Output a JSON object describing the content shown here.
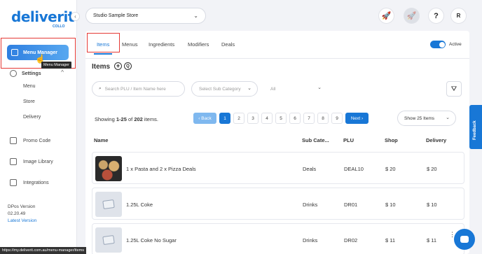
{
  "sidebar": {
    "logo": "deliverit",
    "logo_sub": "COLLO",
    "menu_manager": "Menu Manager",
    "tooltip": "Menu Manager",
    "settings": "Settings",
    "settings_sub": [
      "Menu",
      "Store",
      "Delivery"
    ],
    "items": [
      "Promo Code",
      "Image Library",
      "Integrations"
    ],
    "version_label": "DPos Version",
    "version": "02.20.49",
    "latest": "Latest Version"
  },
  "topbar": {
    "store": "Studio Sample Store",
    "help": "?",
    "user_initial": "R"
  },
  "tabs": [
    "Items",
    "Menus",
    "Ingredients",
    "Modifiers",
    "Deals"
  ],
  "active_tab": "Items",
  "toggle_label": "Active",
  "section_title": "Items",
  "search": {
    "placeholder": "Search PLU / Item Name here"
  },
  "subcategory": {
    "placeholder": "Select Sub Category"
  },
  "all_select": "All",
  "summary": {
    "prefix": "Showing ",
    "range": "1-25",
    "of": " of ",
    "total": "202",
    "suffix": " items."
  },
  "pagination": {
    "back": "‹ Back",
    "pages": [
      "1",
      "2",
      "3",
      "4",
      "5",
      "6",
      "7",
      "8",
      "9"
    ],
    "next": "Next ›"
  },
  "page_size": "Show 25 Items",
  "columns": [
    "Name",
    "Sub Cate...",
    "PLU",
    "Shop",
    "Delivery"
  ],
  "rows": [
    {
      "name": "1 x Pasta and 2 x Pizza Deals",
      "sub": "Deals",
      "plu": "DEAL10",
      "shop": "$ 20",
      "delivery": "$ 20",
      "image": "food"
    },
    {
      "name": "1.25L Coke",
      "sub": "Drinks",
      "plu": "DR01",
      "shop": "$ 10",
      "delivery": "$ 10",
      "image": "placeholder"
    },
    {
      "name": "1.25L Coke No Sugar",
      "sub": "Drinks",
      "plu": "DR02",
      "shop": "$ 11",
      "delivery": "$ 11",
      "image": "placeholder"
    }
  ],
  "feedback": "Feedback",
  "status_url": "https://my.deliverit.com.au/menu-manager/items",
  "colors": {
    "accent": "#1877d6",
    "highlight": "#e53935"
  }
}
